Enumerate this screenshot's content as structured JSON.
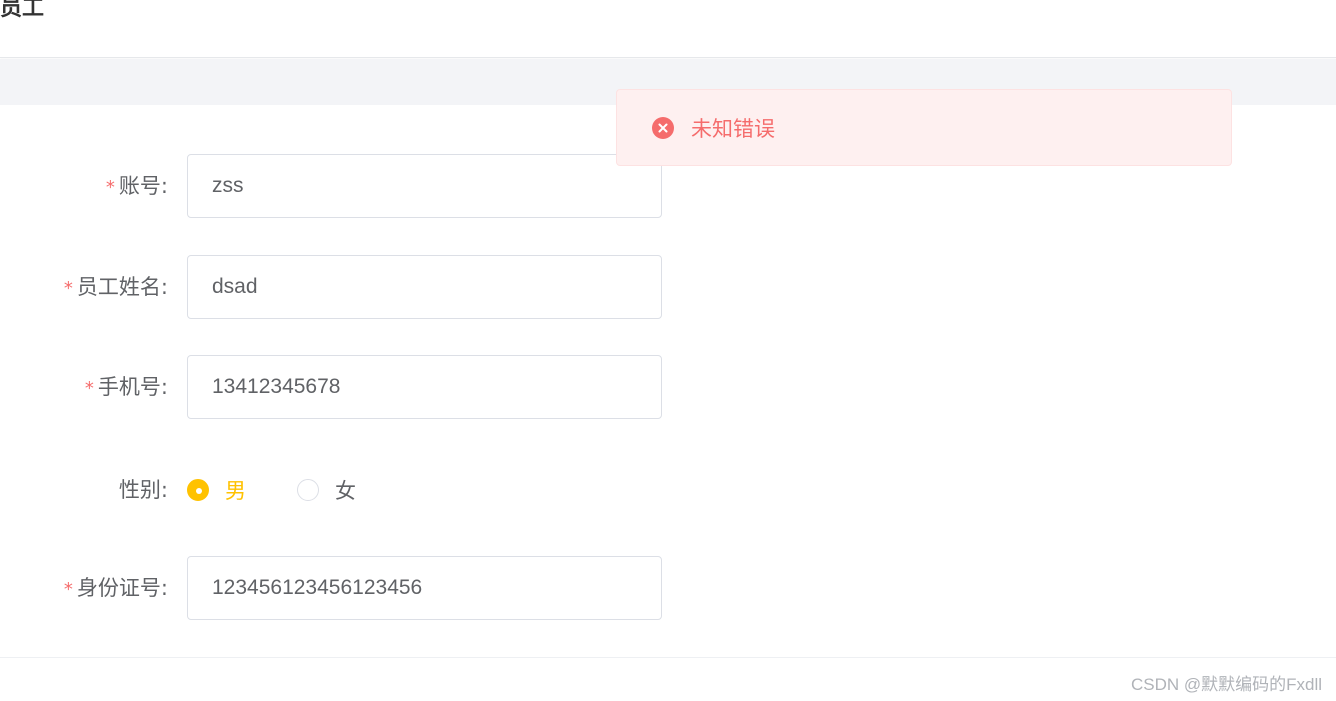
{
  "header": {
    "title": "加员工"
  },
  "form": {
    "account": {
      "required_mark": "*",
      "label": "账号:",
      "value": "zss"
    },
    "name": {
      "required_mark": "*",
      "label": "员工姓名:",
      "value": "dsad"
    },
    "phone": {
      "required_mark": "*",
      "label": "手机号:",
      "value": "13412345678"
    },
    "gender": {
      "label": "性别:",
      "options": [
        {
          "label": "男",
          "checked": true
        },
        {
          "label": "女",
          "checked": false
        }
      ]
    },
    "id_number": {
      "required_mark": "*",
      "label": "身份证号:",
      "value": "123456123456123456"
    }
  },
  "toast": {
    "type": "error",
    "icon": "close-circle-icon",
    "message": "未知错误"
  },
  "watermark": "CSDN @默默编码的Fxdll",
  "colors": {
    "accent": "#ffc200",
    "error": "#f56c6c",
    "error_bg": "#fef0f0",
    "border": "#dcdfe6",
    "text": "#606266"
  }
}
